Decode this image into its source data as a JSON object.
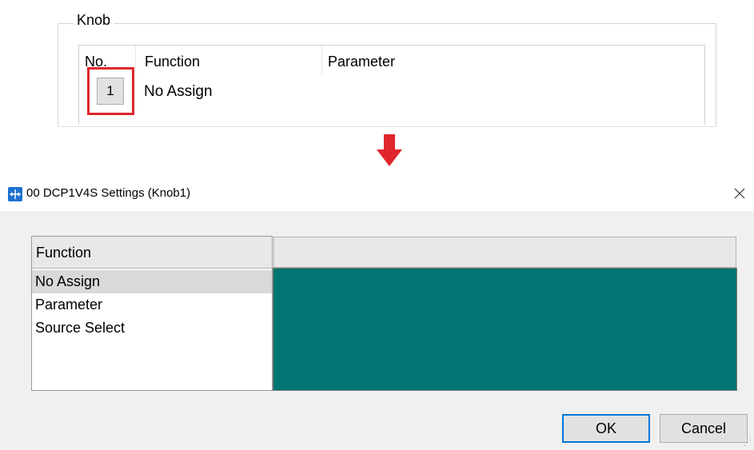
{
  "knob_group": {
    "title": "Knob",
    "columns": [
      "No.",
      "Function",
      "Parameter"
    ],
    "row": {
      "number": "1",
      "function": "No Assign",
      "parameter": ""
    },
    "highlight_color": "#e0262d"
  },
  "arrow": {
    "icon": "down-arrow-icon",
    "color": "#e0262d"
  },
  "dialog": {
    "title": "00 DCP1V4S Settings (Knob1)",
    "app_icon": "app-icon",
    "close_icon": "close-icon",
    "function_list": {
      "header": "Function",
      "items": [
        "No Assign",
        "Parameter",
        "Source Select"
      ],
      "selected": "No Assign"
    },
    "detail_panel": {
      "header": "",
      "color": "#007571"
    },
    "buttons": {
      "ok": "OK",
      "cancel": "Cancel"
    }
  }
}
